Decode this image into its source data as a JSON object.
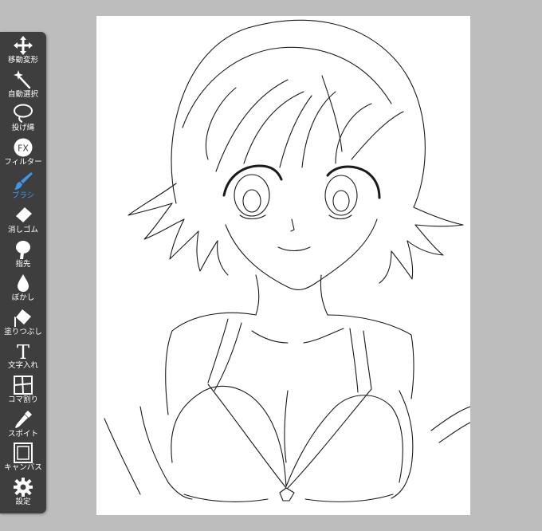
{
  "toolbar": {
    "tools": [
      {
        "label": "移動変形",
        "icon": "move-icon"
      },
      {
        "label": "自動選択",
        "icon": "magic-wand-icon"
      },
      {
        "label": "投げ縄",
        "icon": "lasso-icon"
      },
      {
        "label": "フィルター",
        "icon": "fx-icon",
        "icon_text": "FX"
      },
      {
        "label": "ブラシ",
        "icon": "brush-icon",
        "active": true
      },
      {
        "label": "消しゴム",
        "icon": "eraser-icon"
      },
      {
        "label": "指先",
        "icon": "finger-icon"
      },
      {
        "label": "ぼかし",
        "icon": "blur-drop-icon"
      },
      {
        "label": "塗りつぶし",
        "icon": "fill-bucket-icon"
      },
      {
        "label": "文字入れ",
        "icon": "text-icon",
        "icon_text": "T"
      },
      {
        "label": "コマ割り",
        "icon": "frame-divider-icon"
      },
      {
        "label": "スポイト",
        "icon": "eyedropper-icon"
      },
      {
        "label": "キャンバス",
        "icon": "canvas-icon"
      },
      {
        "label": "設定",
        "icon": "gear-icon"
      }
    ]
  },
  "colors": {
    "background": "#bdbdbd",
    "toolbar": "#3e3e3e",
    "active_accent": "#3d97ea",
    "label": "#ffffff",
    "canvas": "#ffffff",
    "line_art": "#1a1a1a"
  }
}
